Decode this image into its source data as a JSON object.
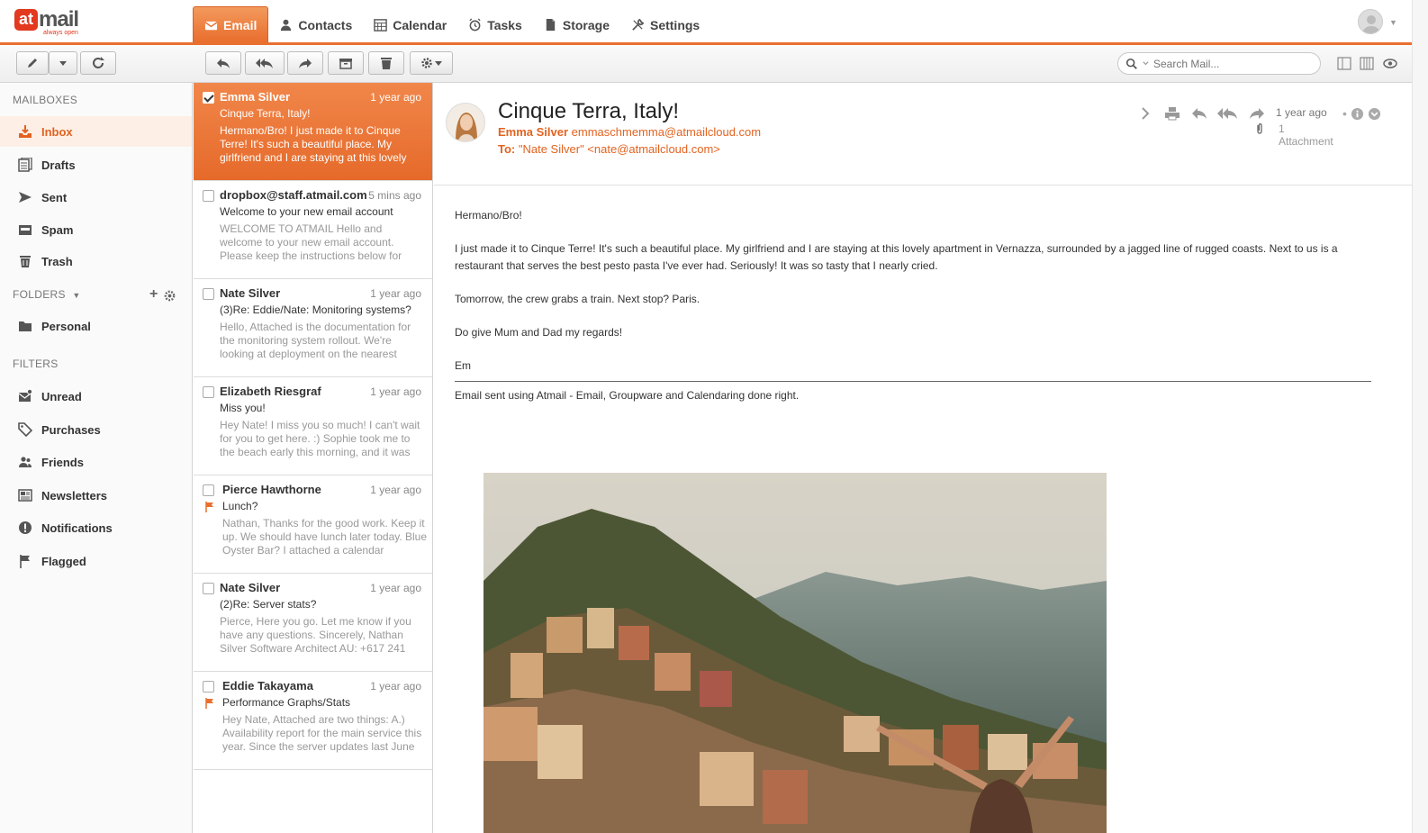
{
  "app": {
    "logo_at": "at",
    "logo_mail": "mail",
    "logo_tagline": "always open",
    "brand_color": "#e96f2f"
  },
  "nav": [
    {
      "label": "Email",
      "icon": "envelope-icon",
      "active": true
    },
    {
      "label": "Contacts",
      "icon": "person-icon"
    },
    {
      "label": "Calendar",
      "icon": "calendar-icon"
    },
    {
      "label": "Tasks",
      "icon": "alarm-clock-icon"
    },
    {
      "label": "Storage",
      "icon": "file-icon"
    },
    {
      "label": "Settings",
      "icon": "wrench-icon"
    }
  ],
  "search": {
    "placeholder": "Search Mail..."
  },
  "sidebar": {
    "mailboxes_title": "MAILBOXES",
    "mailboxes": [
      {
        "label": "Inbox",
        "icon": "inbox-icon",
        "active": true
      },
      {
        "label": "Drafts",
        "icon": "drafts-icon"
      },
      {
        "label": "Sent",
        "icon": "send-icon"
      },
      {
        "label": "Spam",
        "icon": "spam-icon"
      },
      {
        "label": "Trash",
        "icon": "trash-icon"
      }
    ],
    "folders_title": "FOLDERS",
    "folders": [
      {
        "label": "Personal",
        "icon": "folder-icon"
      }
    ],
    "filters_title": "FILTERS",
    "filters": [
      {
        "label": "Unread",
        "icon": "unread-icon"
      },
      {
        "label": "Purchases",
        "icon": "tag-icon"
      },
      {
        "label": "Friends",
        "icon": "people-icon"
      },
      {
        "label": "Newsletters",
        "icon": "newspaper-icon"
      },
      {
        "label": "Notifications",
        "icon": "alert-icon"
      },
      {
        "label": "Flagged",
        "icon": "flag-icon"
      }
    ]
  },
  "messages": [
    {
      "from": "Emma Silver",
      "time": "1 year ago",
      "subject": "Cinque Terra, Italy!",
      "preview": "Hermano/Bro! I just made it to Cinque Terre! It's such a beautiful place. My girlfriend and I are staying at this lovely",
      "selected": true,
      "checked": true,
      "flagged": false
    },
    {
      "from": "dropbox@staff.atmail.com",
      "time": "5 mins ago",
      "subject": "Welcome to your new email account",
      "preview": "WELCOME TO ATMAIL Hello and welcome to your new email account. Please keep the instructions below for",
      "selected": false,
      "checked": false,
      "flagged": false
    },
    {
      "from": "Nate Silver",
      "time": "1 year ago",
      "subject": "(3)Re: Eddie/Nate: Monitoring systems?",
      "preview": "Hello, Attached is the documentation for the monitoring system rollout. We're looking at deployment on the nearest",
      "selected": false,
      "checked": false,
      "flagged": false
    },
    {
      "from": "Elizabeth Riesgraf",
      "time": "1 year ago",
      "subject": "Miss you!",
      "preview": "Hey Nate! I miss you so much! I can't wait for you to get here. :) Sophie took me to the beach early this morning, and it was",
      "selected": false,
      "checked": false,
      "flagged": false
    },
    {
      "from": "Pierce Hawthorne",
      "time": "1 year ago",
      "subject": "Lunch?",
      "preview": "Nathan, Thanks for the good work. Keep it up. We should have lunch later today. Blue Oyster Bar? I attached a calendar",
      "selected": false,
      "checked": false,
      "flagged": true
    },
    {
      "from": "Nate Silver",
      "time": "1 year ago",
      "subject": "(2)Re: Server stats?",
      "preview": "Pierce, Here you go. Let me know if you have any questions. Sincerely, Nathan Silver Software Architect AU: +617 241",
      "selected": false,
      "checked": false,
      "flagged": false
    },
    {
      "from": "Eddie Takayama",
      "time": "1 year ago",
      "subject": "Performance Graphs/Stats",
      "preview": "Hey Nate, Attached are two things: A.) Availability report for the main service this year. Since the server updates last June",
      "selected": false,
      "checked": false,
      "flagged": true
    }
  ],
  "reader": {
    "title": "Cinque Terra, Italy!",
    "from_name": "Emma Silver",
    "from_email": "emmaschmemma@atmailcloud.com",
    "to_label": "To:",
    "to_value": "\"Nate Silver\" <nate@atmailcloud.com>",
    "time": "1 year ago",
    "attachment_count": "1",
    "attachment_label": "Attachment",
    "body": [
      "Hermano/Bro!",
      "I just made it to Cinque Terre! It's such a beautiful place. My girlfriend and I are staying at this lovely apartment in Vernazza, surrounded by a jagged line of rugged coasts. Next to us is a restaurant that serves the best pesto pasta I've ever had. Seriously! It was so tasty that I nearly cried.",
      "Tomorrow, the crew grabs a train. Next stop? Paris.",
      "Do give Mum and Dad my regards!",
      "Em"
    ],
    "signature": "Email sent using Atmail - Email, Groupware and Calendaring done right."
  }
}
